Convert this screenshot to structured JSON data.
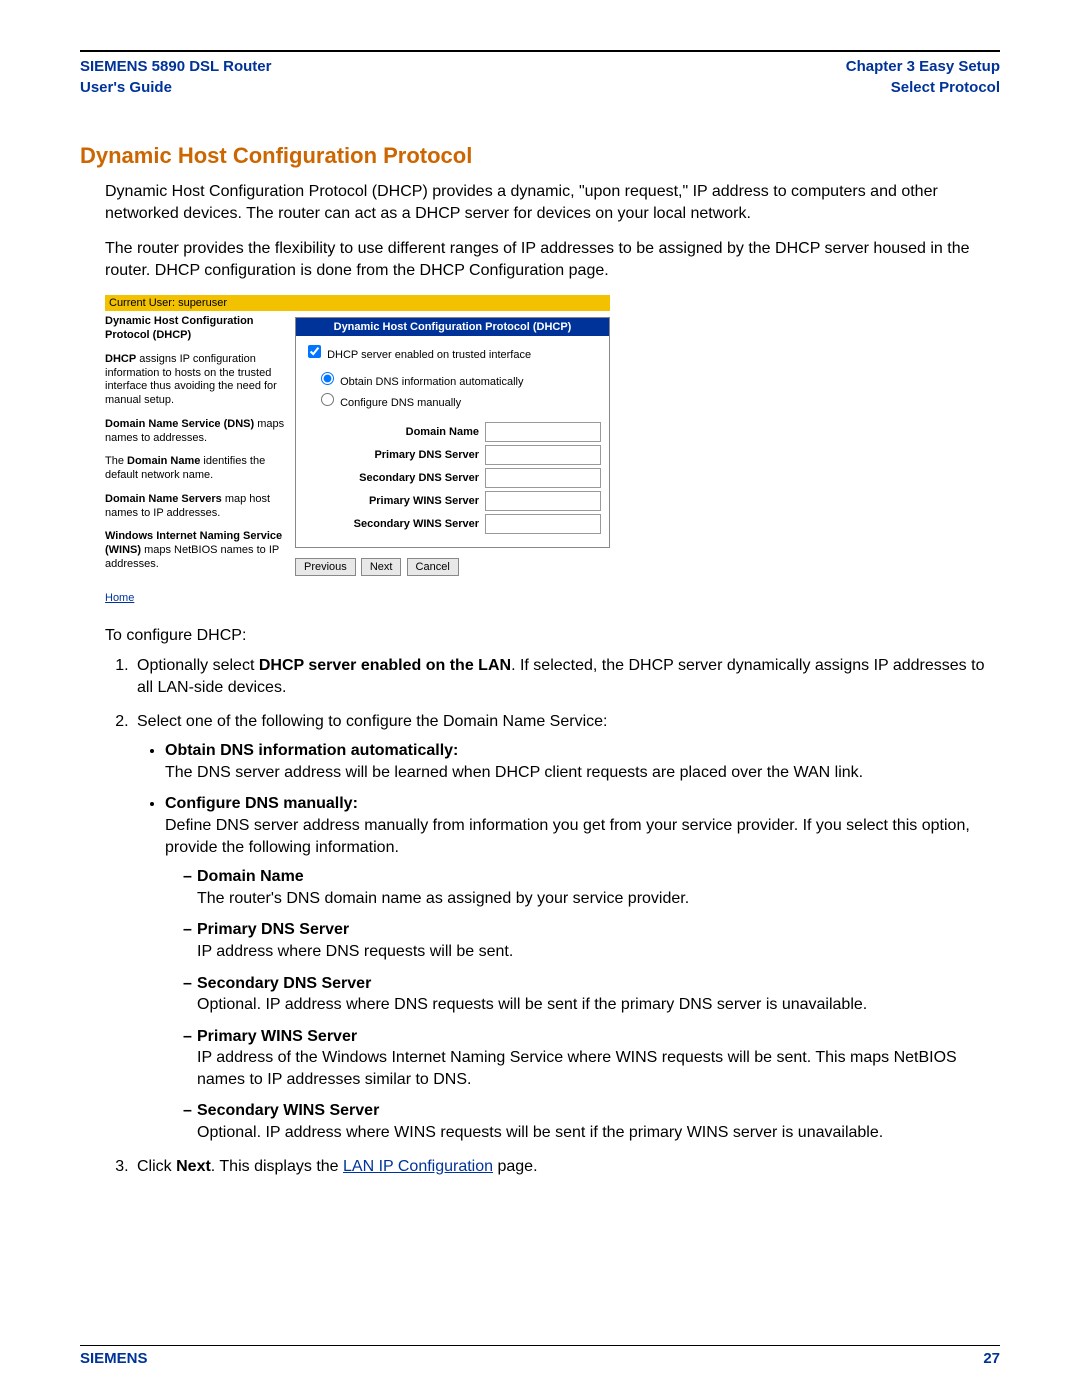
{
  "header": {
    "left1": "SIEMENS 5890 DSL Router",
    "left2": "User's Guide",
    "right1": "Chapter 3  Easy Setup",
    "right2": "Select Protocol"
  },
  "section_title": "Dynamic Host Configuration Protocol",
  "para1": "Dynamic Host Configuration Protocol (DHCP) provides a dynamic, \"upon request,\" IP address to computers and other networked devices. The router can act as a DHCP server for devices on your local network.",
  "para2": "The router provides the flexibility to use different ranges of IP addresses to be assigned by the DHCP server housed in the router. DHCP configuration is done from the DHCP Configuration page.",
  "panel": {
    "userbar": "Current User: superuser",
    "left_title": "Dynamic Host Configuration Protocol (DHCP)",
    "blk1_pre": "DHCP",
    "blk1_rest": " assigns IP configuration information to hosts on the trusted interface thus avoiding the need for manual setup.",
    "blk2_pre": "Domain Name Service (DNS)",
    "blk2_rest": " maps names to addresses.",
    "blk3_pre_a": "The ",
    "blk3_bold": "Domain Name",
    "blk3_rest": " identifies the default network name.",
    "blk4_pre": "Domain Name Servers",
    "blk4_rest": " map host names to IP addresses.",
    "blk5_pre": "Windows Internet Naming Service (WINS)",
    "blk5_rest": " maps NetBIOS names to IP addresses.",
    "home": "Home",
    "box_title": "Dynamic Host Configuration Protocol (DHCP)",
    "chk1": "DHCP server enabled on trusted interface",
    "rad1": "Obtain DNS information automatically",
    "rad2": "Configure DNS manually",
    "f1": "Domain Name",
    "f2": "Primary DNS Server",
    "f3": "Secondary DNS Server",
    "f4": "Primary WINS Server",
    "f5": "Secondary WINS Server",
    "btn_prev": "Previous",
    "btn_next": "Next",
    "btn_cancel": "Cancel"
  },
  "intro": "To configure DHCP:",
  "step1_a": "Optionally select ",
  "step1_b": "DHCP server enabled on the LAN",
  "step1_c": ". If selected, the DHCP server dynamically assigns IP addresses to all LAN-side devices.",
  "step2": "Select one of the following to configure the Domain Name Service:",
  "bul1_t": "Obtain DNS information automatically:",
  "bul1_d": "The DNS server address will be learned when DHCP client requests are placed over the WAN link.",
  "bul2_t": "Configure DNS manually:",
  "bul2_d": "Define DNS server address manually from information you get from your service provider. If you select this option, provide the following information.",
  "d1_t": "Domain Name",
  "d1_d": "The router's DNS domain name as assigned by your service provider.",
  "d2_t": "Primary DNS Server",
  "d2_d": "IP address where DNS requests will be sent.",
  "d3_t": "Secondary DNS Server",
  "d3_d": "Optional. IP address where DNS requests will be sent if the primary DNS server is unavailable.",
  "d4_t": "Primary WINS Server",
  "d4_d": "IP address of the Windows Internet Naming Service where WINS requests will be sent. This maps NetBIOS names to IP addresses similar to DNS.",
  "d5_t": "Secondary WINS Server",
  "d5_d": "Optional. IP address where WINS requests will be sent if the primary WINS server is unavailable.",
  "step3_a": "Click ",
  "step3_b": "Next",
  "step3_c": ". This displays the ",
  "step3_link": "LAN IP Configuration",
  "step3_d": " page.",
  "footer_left": "SIEMENS",
  "footer_right": "27"
}
